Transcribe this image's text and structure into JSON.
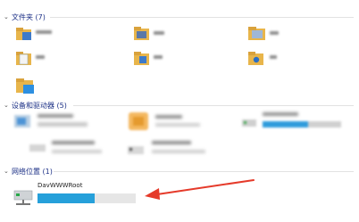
{
  "sections": [
    {
      "title": "文件夹 (7)"
    },
    {
      "title": "设备和驱动器 (5)"
    },
    {
      "title": "网络位置 (1)"
    }
  ],
  "network_drive": {
    "label": "DavWWWRoot",
    "usage_fraction": 0.58
  },
  "colors": {
    "section_title": "#1e3287",
    "accent_bar": "#26a0da",
    "arrow": "#e53a2a"
  }
}
